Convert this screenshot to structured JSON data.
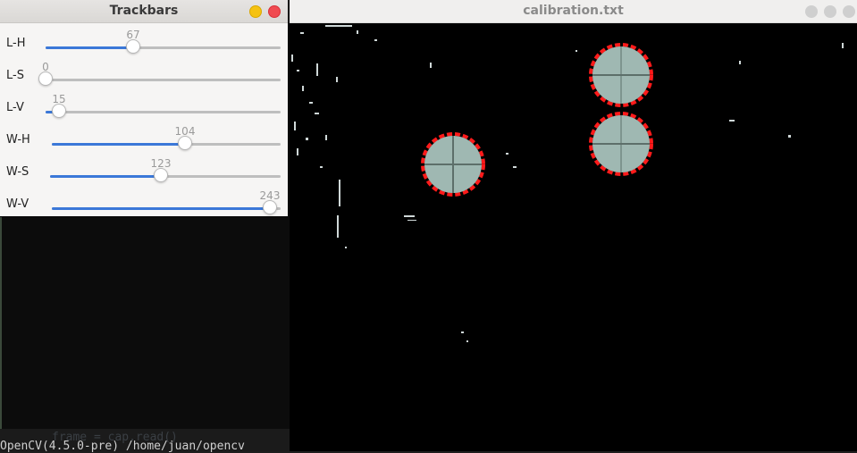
{
  "terminal": {
    "code_line": "frame = cap.read()",
    "output_line": "OpenCV(4.5.0-pre) /home/juan/opencv"
  },
  "calibration_window": {
    "title": "calibration.txt",
    "active": false
  },
  "trackbars_window": {
    "title": "Trackbars",
    "sliders": [
      {
        "label": "L-H",
        "value": 67,
        "max": 179
      },
      {
        "label": "L-S",
        "value": 0,
        "max": 255
      },
      {
        "label": "L-V",
        "value": 15,
        "max": 255
      },
      {
        "label": "W-H",
        "value": 104,
        "max": 179
      },
      {
        "label": "W-S",
        "value": 123,
        "max": 255
      },
      {
        "label": "W-V",
        "value": 243,
        "max": 255
      }
    ]
  },
  "colors": {
    "slider_fill": "#3b78d8",
    "contour": "#ff1a1a",
    "marker_fill": "#9fb8b2",
    "close_button": "#f04a50",
    "minimize_button": "#f5c211"
  },
  "icons": {
    "minimize": "minimize-icon",
    "close": "close-icon"
  }
}
